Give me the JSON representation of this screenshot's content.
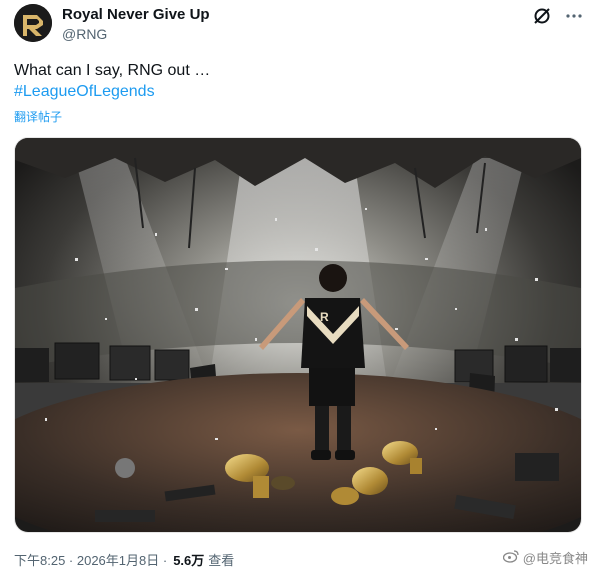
{
  "post": {
    "author_name": "Royal Never Give Up",
    "author_handle": "@RNG",
    "text": "What can I say, RNG out …",
    "hashtag": "#LeagueOfLegends",
    "translate_label": "翻译帖子",
    "timestamp": "下午8:25 · 2026年1月8日 ·",
    "views_count": "5.6万",
    "views_label": "查看"
  },
  "watermark": {
    "text": "@电竞食神"
  },
  "colors": {
    "link": "#1d9bf0",
    "secondary_text": "#536471"
  },
  "icons": {
    "header": [
      "grok-icon",
      "more-icon"
    ],
    "watermark": "weibo-icon"
  }
}
